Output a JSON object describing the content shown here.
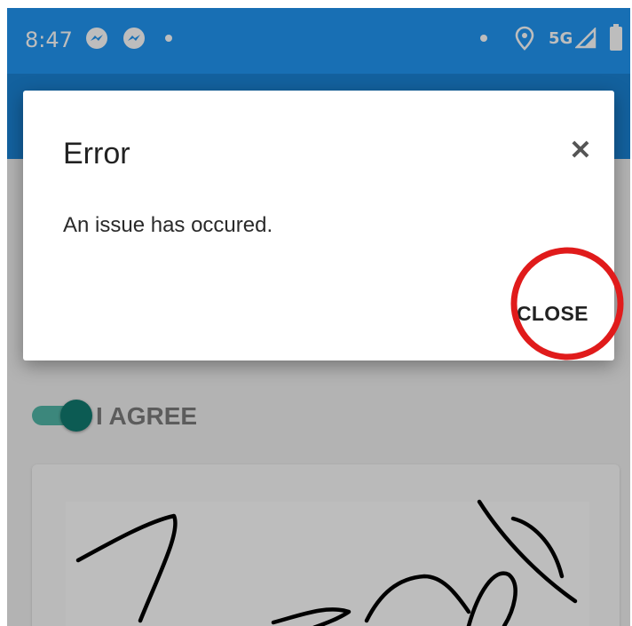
{
  "status_bar": {
    "time": "8:47",
    "network": "5G",
    "icons": [
      "messenger-icon",
      "messenger-icon",
      "location-icon",
      "signal-icon",
      "battery-icon"
    ],
    "color": "#2196f3"
  },
  "app_bar": {
    "color": "#1a83d6"
  },
  "agreement": {
    "toggle_label": "I AGREE",
    "toggle_on": true,
    "toggle_color": "#117b71"
  },
  "dialog": {
    "title": "Error",
    "message": "An issue has occured.",
    "close_button_label": "CLOSE",
    "close_icon": "close-icon",
    "highlight_color": "#e01b1b"
  }
}
